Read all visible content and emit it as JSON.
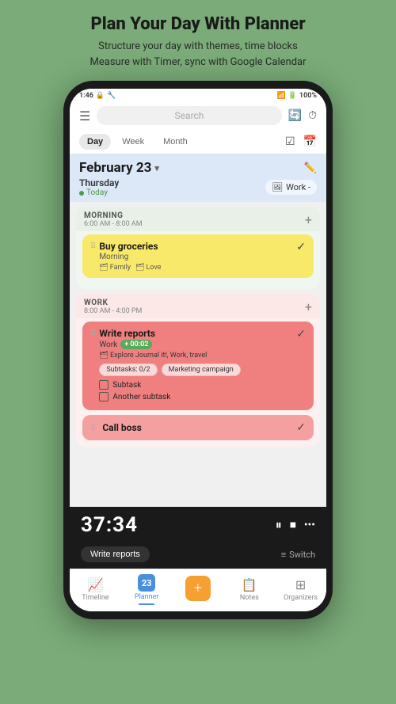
{
  "page": {
    "header": {
      "title": "Plan Your Day With Planner",
      "subtitle": "Structure your day with themes, time blocks\nMeasure with Timer, sync with Google Calendar"
    }
  },
  "status_bar": {
    "time": "1:46",
    "battery": "100%",
    "signal": "▲▼"
  },
  "top_bar": {
    "search_placeholder": "Search"
  },
  "view_tabs": {
    "day": "Day",
    "week": "Week",
    "month": "Month"
  },
  "date_header": {
    "date": "February 23",
    "day": "Thursday",
    "today": "Today",
    "work_label": "Work -"
  },
  "morning_section": {
    "label": "MORNING",
    "time": "6:00 AM - 8:00 AM",
    "task": {
      "title": "Buy groceries",
      "subtitle": "Morning",
      "tags": [
        "Family",
        "Love"
      ]
    }
  },
  "work_section": {
    "label": "WORK",
    "time": "8:00 AM - 4:00 PM",
    "task1": {
      "title": "Write reports",
      "subtitle": "Work",
      "time_extra": "+ 00:02",
      "tags": "Explore Journal it!, Work, travel",
      "chip1": "Subtasks: 0/2",
      "chip2": "Marketing campaign",
      "subtask1": "Subtask",
      "subtask2": "Another subtask"
    },
    "task2": {
      "title": "Call boss"
    }
  },
  "timer": {
    "display": "37:34",
    "task_label": "Write reports",
    "switch_label": "Switch"
  },
  "bottom_nav": {
    "timeline": "Timeline",
    "planner": "Planner",
    "create": "+",
    "notes": "Notes",
    "organizers": "Organizers",
    "planner_date": "23"
  }
}
